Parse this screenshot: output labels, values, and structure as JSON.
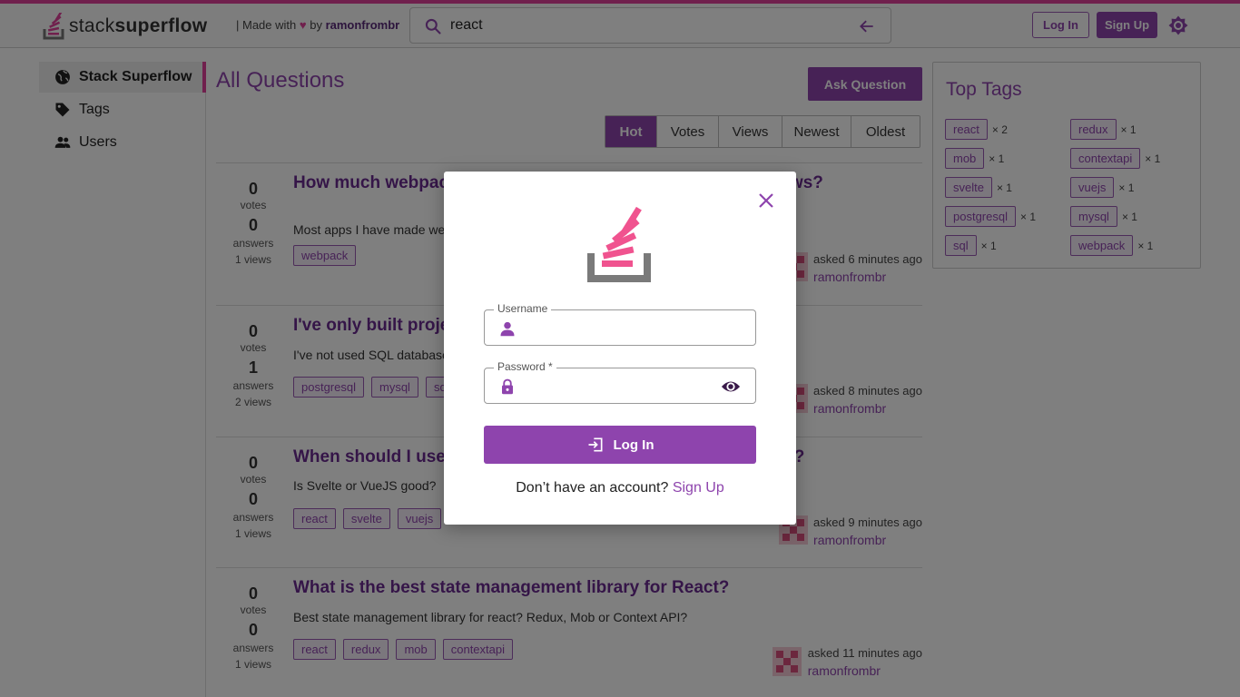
{
  "header": {
    "brand_light": "stack",
    "brand_bold": "superflow",
    "made_with": "| Made with",
    "by": "by",
    "author": "ramonfrombr",
    "search_value": "react",
    "login_label": "Log In",
    "signup_label": "Sign Up"
  },
  "sidebar": {
    "items": [
      {
        "label": "Stack Superflow",
        "icon": "globe-icon"
      },
      {
        "label": "Tags",
        "icon": "tag-icon"
      },
      {
        "label": "Users",
        "icon": "users-icon"
      }
    ]
  },
  "main": {
    "title": "All Questions",
    "ask_label": "Ask Question",
    "sort_tabs": [
      "Hot",
      "Votes",
      "Views",
      "Newest",
      "Oldest"
    ],
    "active_sort": "Hot",
    "labels": {
      "votes": "votes",
      "answers": "answers"
    },
    "questions": [
      {
        "title": "How much webpack knowledge is expected in junior interviews?",
        "excerpt": "Most apps I have made were created with create-react-app.",
        "votes": "0",
        "answers": "0",
        "views": "1 views",
        "tags": [
          "webpack"
        ],
        "asked": "asked 6 minutes ago",
        "user": "ramonfrombr"
      },
      {
        "title": "I've only built projects using MongoDB",
        "excerpt": "I've not used SQL databases yet.",
        "votes": "0",
        "answers": "1",
        "views": "2 views",
        "tags": [
          "postgresql",
          "mysql",
          "sql"
        ],
        "asked": "asked 8 minutes ago",
        "user": "ramonfrombr"
      },
      {
        "title": "When should I use Svelte or VueJS? Are they getting popular?",
        "excerpt": "Is Svelte or VueJS good?",
        "votes": "0",
        "answers": "0",
        "views": "1 views",
        "tags": [
          "react",
          "svelte",
          "vuejs"
        ],
        "asked": "asked 9 minutes ago",
        "user": "ramonfrombr"
      },
      {
        "title": "What is the best state management library for React?",
        "excerpt": "Best state management library for react? Redux, Mob or Context API?",
        "votes": "0",
        "answers": "0",
        "views": "1 views",
        "tags": [
          "react",
          "redux",
          "mob",
          "contextapi"
        ],
        "asked": "asked 11 minutes ago",
        "user": "ramonfrombr"
      }
    ]
  },
  "top_tags": {
    "title": "Top Tags",
    "tags": [
      {
        "name": "react",
        "count": "× 2"
      },
      {
        "name": "redux",
        "count": "× 1"
      },
      {
        "name": "mob",
        "count": "× 1"
      },
      {
        "name": "contextapi",
        "count": "× 1"
      },
      {
        "name": "svelte",
        "count": "× 1"
      },
      {
        "name": "vuejs",
        "count": "× 1"
      },
      {
        "name": "postgresql",
        "count": "× 1"
      },
      {
        "name": "mysql",
        "count": "× 1"
      },
      {
        "name": "sql",
        "count": "× 1"
      },
      {
        "name": "webpack",
        "count": "× 1"
      }
    ]
  },
  "modal": {
    "username_label": "Username",
    "password_label": "Password *",
    "login_label": "Log In",
    "footer_text": "Don’t have an account?",
    "signup_link": "Sign Up"
  },
  "colors": {
    "accent": "#8e44ad",
    "brand_pink": "#e0409a"
  }
}
